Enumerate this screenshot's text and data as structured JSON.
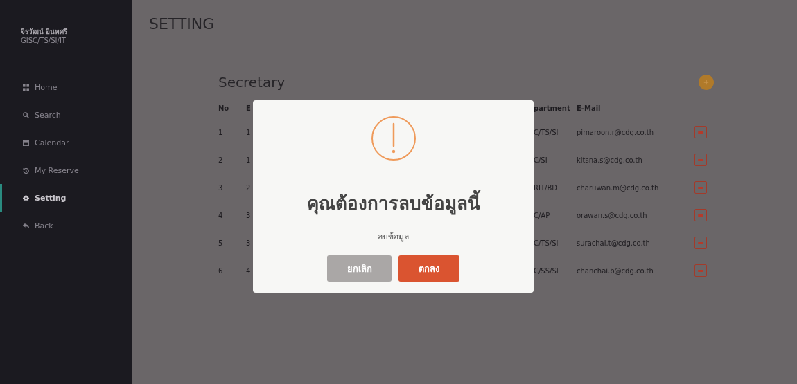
{
  "user": {
    "name": "จิรวัฒน์ อินทศรี",
    "unit": "GISC/TS/SI/IT"
  },
  "sidebar": {
    "items": [
      {
        "label": "Home",
        "kind": "home",
        "selected": false
      },
      {
        "label": "Search",
        "kind": "search",
        "selected": false
      },
      {
        "label": "Calendar",
        "kind": "calendar",
        "selected": false
      },
      {
        "label": "My Reserve",
        "kind": "reserve",
        "selected": false
      },
      {
        "label": "Setting",
        "kind": "setting",
        "selected": true
      },
      {
        "label": "Back",
        "kind": "back",
        "selected": false
      }
    ]
  },
  "page_title": "SETTING",
  "section_title": "Secretary",
  "table": {
    "columns": [
      "No",
      "E",
      "partment",
      "E-Mail"
    ],
    "rows": [
      {
        "no": "1",
        "column_2": "1",
        "department": "C/TS/SI",
        "email": "pimaroon.r@cdg.co.th"
      },
      {
        "no": "2",
        "column_2": "1",
        "department": "C/SI",
        "email": "kitsna.s@cdg.co.th"
      },
      {
        "no": "3",
        "column_2": "2",
        "department": "RIT/BD",
        "email": "charuwan.m@cdg.co.th"
      },
      {
        "no": "4",
        "column_2": "3",
        "department": "C/AP",
        "email": "orawan.s@cdg.co.th"
      },
      {
        "no": "5",
        "column_2": "3",
        "department": "C/TS/SI",
        "email": "surachai.t@cdg.co.th"
      },
      {
        "no": "6",
        "column_2": "4",
        "department": "C/SS/SI",
        "email": "chanchai.b@cdg.co.th"
      }
    ]
  },
  "dialog": {
    "title": "คุณต้องการลบข้อมูลนี้",
    "message": "ลบข้อมูล",
    "buttons": [
      {
        "label": "ยกเลิก",
        "kind": "cancel"
      },
      {
        "label": "ตกลง",
        "kind": "confirm"
      }
    ]
  }
}
